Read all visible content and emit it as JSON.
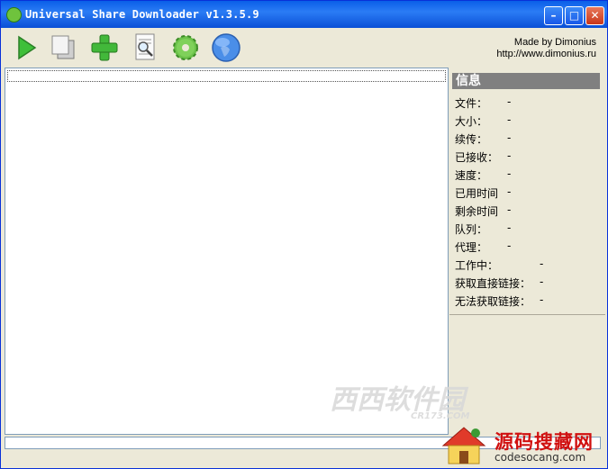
{
  "window": {
    "title": "Universal Share Downloader v1.3.5.9",
    "buttons": {
      "minimize": "–",
      "maximize": "□",
      "close": "✕"
    }
  },
  "toolbar": {
    "tools": [
      "play-icon",
      "copy-icon",
      "add-icon",
      "search-document-icon",
      "settings-gear-icon",
      "globe-icon"
    ],
    "credit_line1": "Made by Dimonius",
    "credit_line2": "http://www.dimonius.ru"
  },
  "info_panel": {
    "header": "信息",
    "rows": [
      {
        "label": "文件：",
        "value": "-"
      },
      {
        "label": "大小：",
        "value": "-"
      },
      {
        "label": "续传：",
        "value": "-"
      },
      {
        "label": "已接收：",
        "value": "-"
      },
      {
        "label": "速度：",
        "value": "-"
      },
      {
        "label": "已用时间",
        "value": "-"
      },
      {
        "label": "剩余时间",
        "value": "-"
      },
      {
        "label": "队列：",
        "value": "-"
      },
      {
        "label": "代理：",
        "value": "-"
      },
      {
        "label": "工作中：",
        "value": "-"
      },
      {
        "label": "获取直接链接：",
        "value": "-"
      },
      {
        "label": "无法获取链接：",
        "value": "-"
      }
    ]
  },
  "colors": {
    "titlebar": "#0a5fe8",
    "panel_header": "#808080",
    "window_bg": "#ece9d8"
  },
  "watermarks": {
    "cr173_text": "西西软件园",
    "cr173_sub": "CR173.COM",
    "site_cn": "源码搜藏网",
    "site_url": "codesocang.com"
  }
}
